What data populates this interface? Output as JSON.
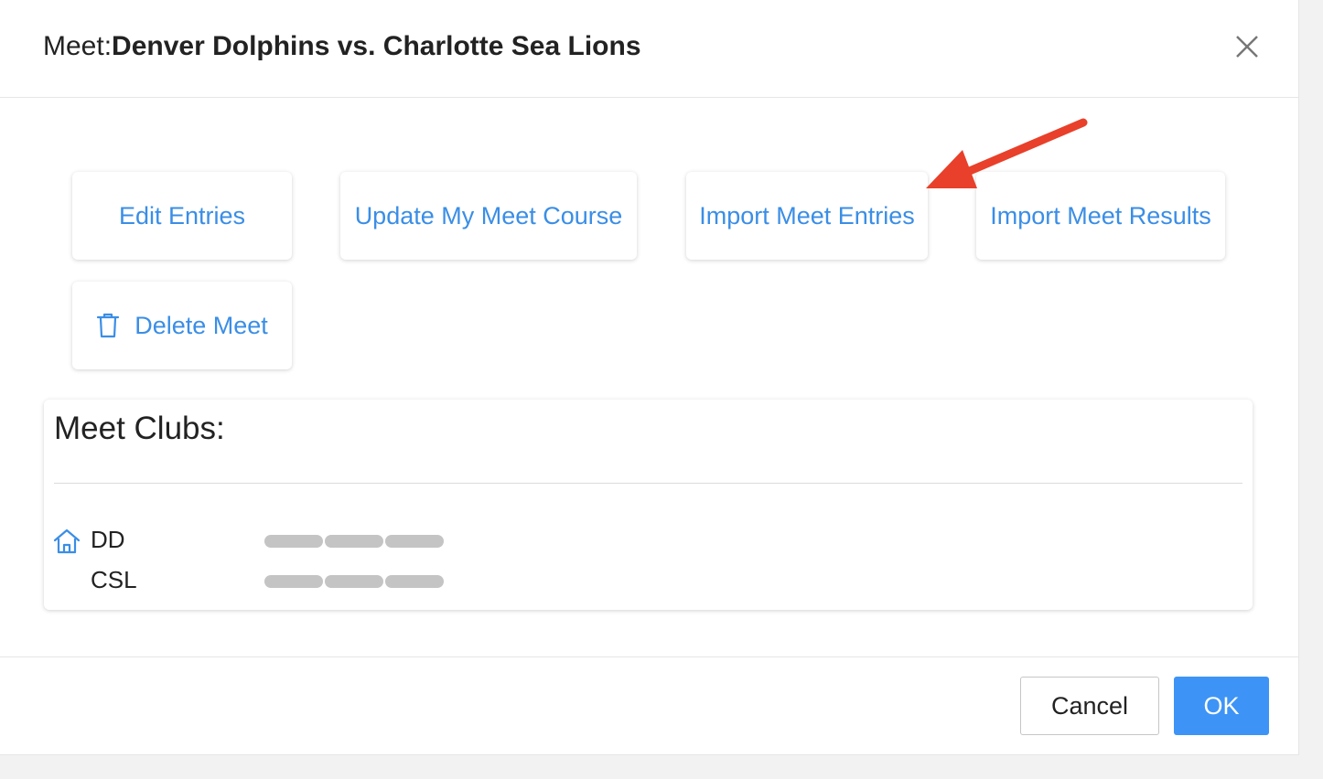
{
  "dialog": {
    "title_prefix": "Meet:",
    "title_name": "Denver Dolphins vs. Charlotte Sea Lions"
  },
  "actions": {
    "edit_entries": "Edit Entries",
    "update_course": "Update My Meet Course",
    "import_entries": "Import Meet Entries",
    "import_results": "Import Meet Results",
    "delete_meet": "Delete Meet"
  },
  "clubs": {
    "title": "Meet Clubs:",
    "items": [
      {
        "code": "DD",
        "home": true,
        "icon": "home-icon"
      },
      {
        "code": "CSL",
        "home": false
      }
    ]
  },
  "footer": {
    "cancel_label": "Cancel",
    "ok_label": "OK"
  },
  "colors": {
    "accent": "#3a8ee6",
    "primary_button": "#3d94f6",
    "annotation_arrow": "#e8402a",
    "redaction": "#c4c4c4"
  },
  "icons": {
    "close": "close-icon",
    "delete": "trash-icon",
    "home": "home-icon"
  }
}
